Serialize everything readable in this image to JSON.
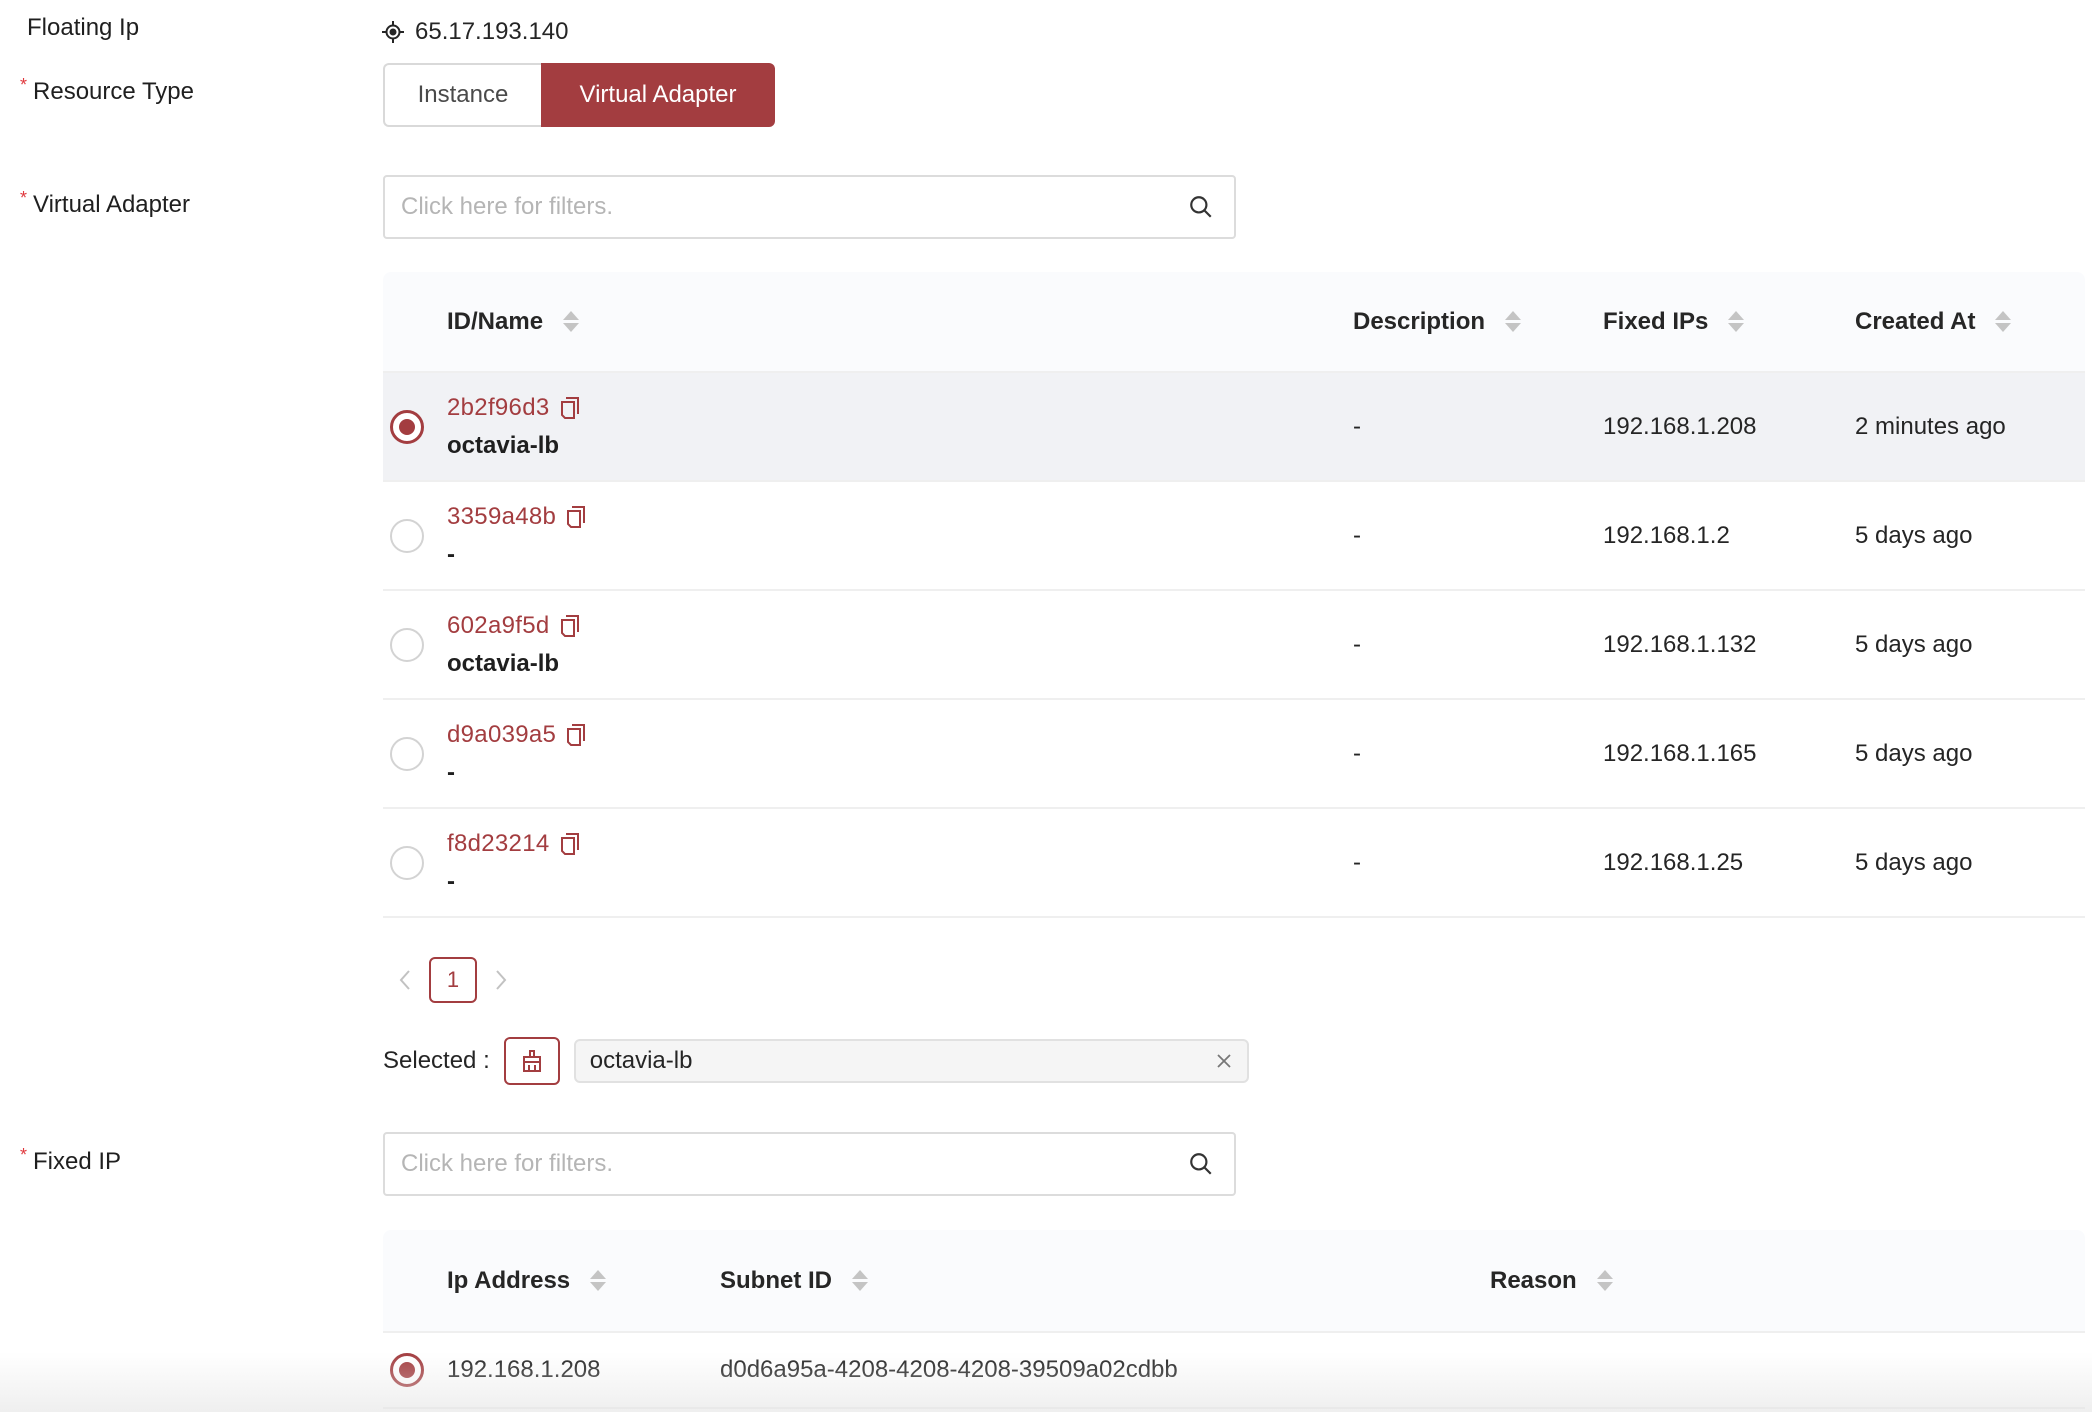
{
  "floating_ip": {
    "label": "Floating Ip",
    "value": "65.17.193.140",
    "icon": "crosshair-icon"
  },
  "resource_type": {
    "label": "Resource Type",
    "required": true,
    "options": [
      "Instance",
      "Virtual Adapter"
    ],
    "selected": "Virtual Adapter"
  },
  "virtual_adapter": {
    "label": "Virtual Adapter",
    "required": true,
    "search_placeholder": "Click here for filters.",
    "columns": [
      "ID/Name",
      "Description",
      "Fixed IPs",
      "Created At"
    ],
    "rows": [
      {
        "id": "2b2f96d3",
        "name": "octavia-lb",
        "description": "-",
        "fixed_ips": "192.168.1.208",
        "created_at": "2 minutes ago",
        "selected": true
      },
      {
        "id": "3359a48b",
        "name": "-",
        "description": "-",
        "fixed_ips": "192.168.1.2",
        "created_at": "5 days ago",
        "selected": false
      },
      {
        "id": "602a9f5d",
        "name": "octavia-lb",
        "description": "-",
        "fixed_ips": "192.168.1.132",
        "created_at": "5 days ago",
        "selected": false
      },
      {
        "id": "d9a039a5",
        "name": "-",
        "description": "-",
        "fixed_ips": "192.168.1.165",
        "created_at": "5 days ago",
        "selected": false
      },
      {
        "id": "f8d23214",
        "name": "-",
        "description": "-",
        "fixed_ips": "192.168.1.25",
        "created_at": "5 days ago",
        "selected": false
      }
    ],
    "pagination": {
      "current_page": "1"
    },
    "selected_label": "Selected :",
    "selected_value": "octavia-lb"
  },
  "fixed_ip": {
    "label": "Fixed IP",
    "required": true,
    "search_placeholder": "Click here for filters.",
    "columns": [
      "Ip Address",
      "Subnet ID",
      "Reason"
    ],
    "rows": [
      {
        "ip_address": "192.168.1.208",
        "subnet_id": "d0d6a95a-4208-4208-4208-39509a02cdbb",
        "reason": "",
        "selected": true
      }
    ]
  },
  "colors": {
    "accent": "#a33d40",
    "required_mark": "#e0393e",
    "selected_row_bg": "#f1f2f5",
    "header_bg": "#fafbfd"
  }
}
